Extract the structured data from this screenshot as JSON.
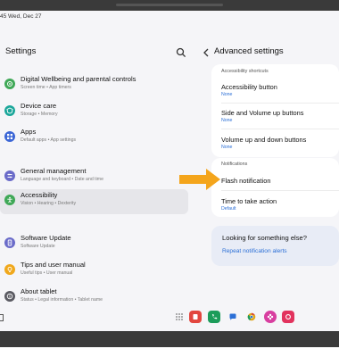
{
  "status_bar": {
    "time_date": "45  Wed, Dec 27"
  },
  "left_panel": {
    "title": "Settings",
    "items": [
      {
        "label": "Digital Wellbeing and parental controls",
        "sub": "Screen time  •  App timers",
        "icon": "wellbeing-icon",
        "color": "#3fa857"
      },
      {
        "label": "Device care",
        "sub": "Storage  •  Memory",
        "icon": "device-care-icon",
        "color": "#1aa69a"
      },
      {
        "label": "Apps",
        "sub": "Default apps  •  App settings",
        "icon": "apps-icon",
        "color": "#3b66d6"
      },
      {
        "label": "General management",
        "sub": "Language and keyboard  •  Date and time",
        "icon": "general-management-icon",
        "color": "#6a6bc9"
      },
      {
        "label": "Accessibility",
        "sub": "Vision  •  Hearing  •  Dexterity",
        "icon": "accessibility-icon",
        "color": "#3fa857"
      },
      {
        "label": "Software Update",
        "sub": "Software Update",
        "icon": "software-update-icon",
        "color": "#6a6bc9"
      },
      {
        "label": "Tips and user manual",
        "sub": "Useful tips  •  User manual",
        "icon": "tips-icon",
        "color": "#f0a81c"
      },
      {
        "label": "About tablet",
        "sub": "Status  •  Legal information  •  Tablet name",
        "icon": "about-icon",
        "color": "#5a5a62"
      }
    ]
  },
  "right_panel": {
    "title": "Advanced settings",
    "accessibility_shortcuts": {
      "label": "Accessibility shortcuts",
      "options": [
        {
          "label": "Accessibility button",
          "sub": "None"
        },
        {
          "label": "Side and Volume up buttons",
          "sub": "None"
        },
        {
          "label": "Volume up and down buttons",
          "sub": "None"
        }
      ]
    },
    "notifications": {
      "label": "Notifications",
      "options": [
        {
          "label": "Flash notification",
          "sub": ""
        },
        {
          "label": "Time to take action",
          "sub": "Default"
        }
      ]
    },
    "looking": {
      "title": "Looking for something else?",
      "link": "Repeat notification alerts"
    }
  },
  "colors": {
    "accent_link": "#2b6fd6",
    "highlight_arrow": "#f4a51c",
    "selected_bg": "#e6e6ea"
  },
  "dock": {
    "apps": [
      {
        "icon": "app-grid-icon",
        "color": "#777777"
      },
      {
        "icon": "notes-icon",
        "color": "#e2463f"
      },
      {
        "icon": "phone-call-icon",
        "color": "#1c9c5a"
      },
      {
        "icon": "messages-icon",
        "color": "#2b6fd6"
      },
      {
        "icon": "chrome-icon",
        "color": "#e0a61b"
      },
      {
        "icon": "bixby-flower-icon",
        "color": "#d83ea0"
      },
      {
        "icon": "camera-icon",
        "color": "#e2335e"
      }
    ]
  }
}
